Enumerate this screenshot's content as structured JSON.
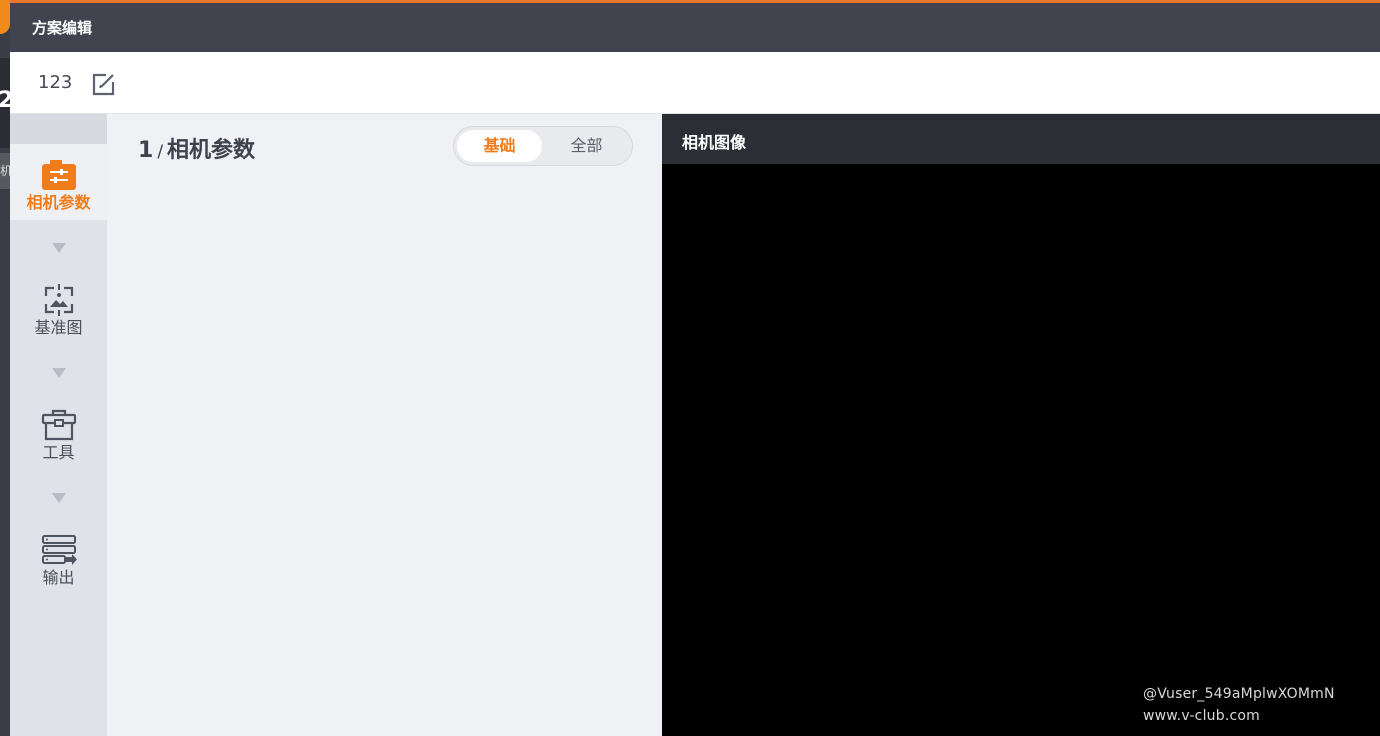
{
  "dialog": {
    "title": "方案编辑"
  },
  "scheme": {
    "name": "123"
  },
  "background": {
    "partial_number": "2",
    "partial_tag": "机参"
  },
  "steps": [
    {
      "label": "相机参数",
      "icon": "camera-params-icon",
      "active": true
    },
    {
      "label": "基准图",
      "icon": "reference-image-icon",
      "active": false
    },
    {
      "label": "工具",
      "icon": "toolbox-icon",
      "active": false
    },
    {
      "label": "输出",
      "icon": "output-icon",
      "active": false
    }
  ],
  "params": {
    "step_number": "1",
    "separator": "/",
    "title": "相机参数",
    "toggle": {
      "basic": "基础",
      "all": "全部",
      "selected": "基础"
    }
  },
  "image_panel": {
    "title": "相机图像"
  },
  "watermark": {
    "line1": "@Vuser_549aMplwXOMmN",
    "line2": "www.v-club.com"
  },
  "colors": {
    "accent": "#f07d1a",
    "titlebar": "#41444f",
    "sidebar": "#dfe2e8",
    "image_bg": "#000000"
  }
}
